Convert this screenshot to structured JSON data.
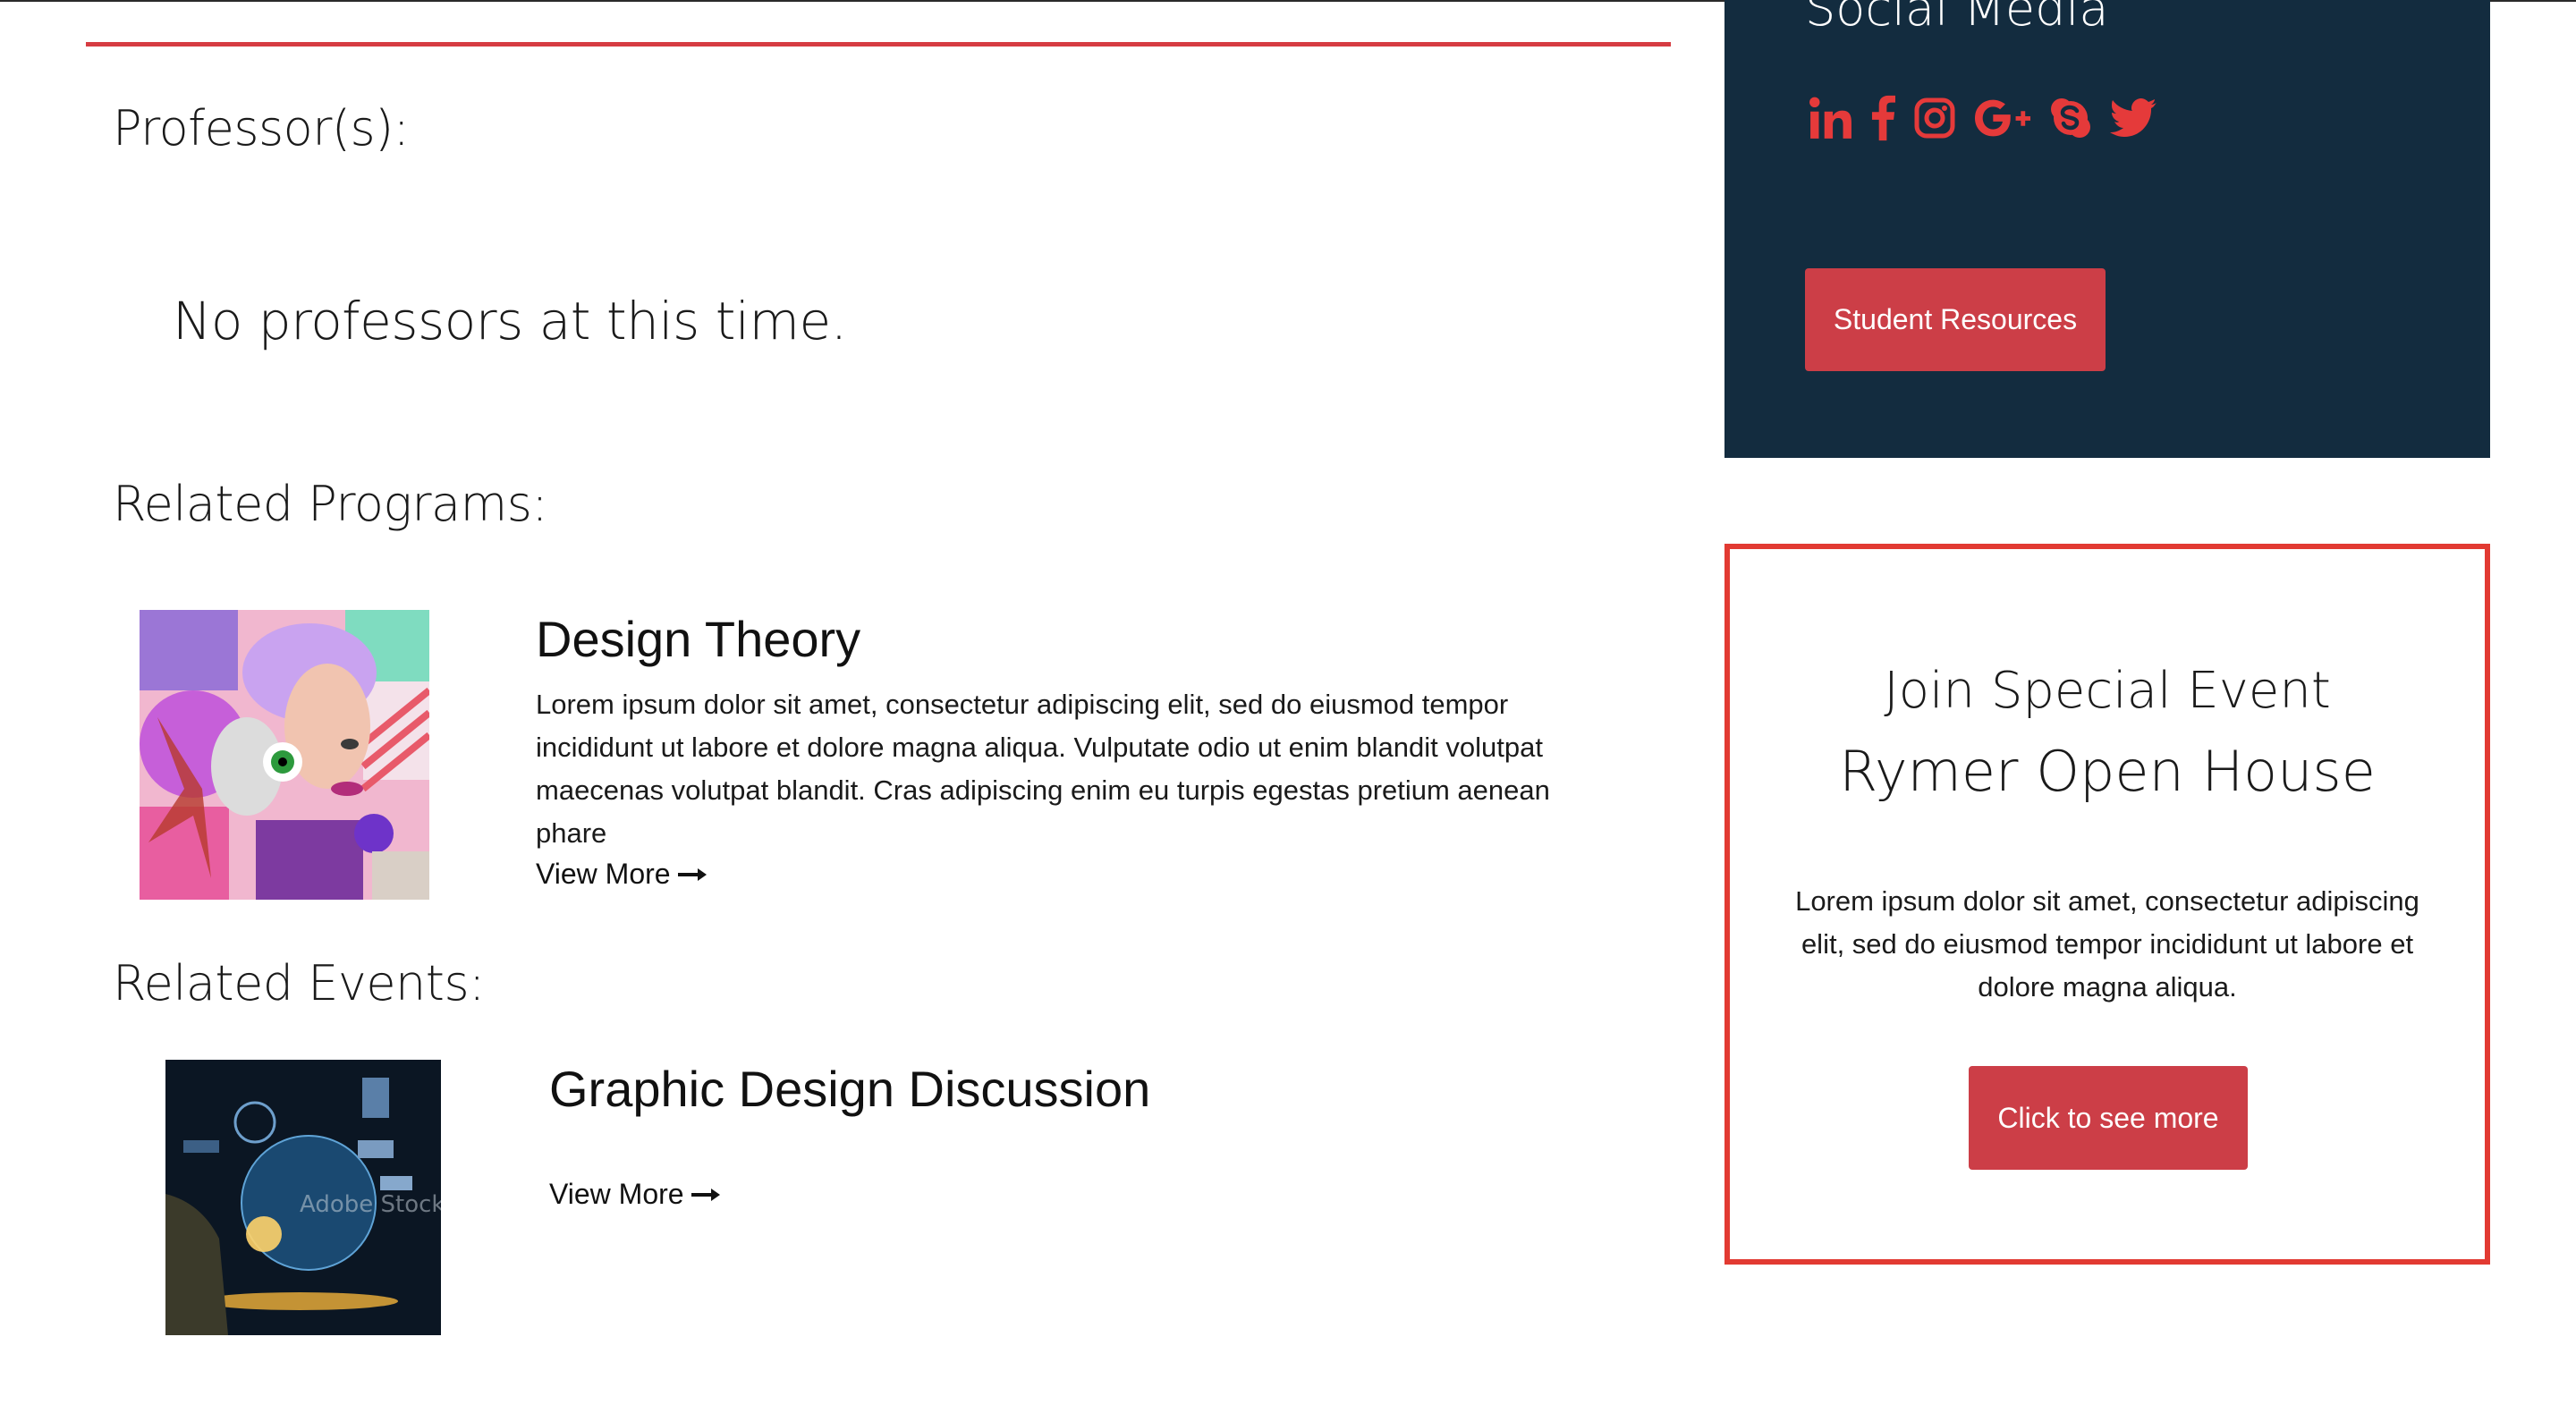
{
  "main": {
    "professors_heading": "Professor(s):",
    "no_professors_message": "No professors at this time.",
    "related_programs_heading": "Related Programs:",
    "program": {
      "title": "Design Theory",
      "description": "Lorem ipsum dolor sit amet, consectetur adipiscing elit, sed do eiusmod tempor incididunt ut labore et dolore magna aliqua. Vulputate odio ut enim blandit volutpat maecenas volutpat blandit. Cras adipiscing enim eu turpis egestas pretium aenean phare",
      "view_more_label": "View More"
    },
    "related_events_heading": "Related Events:",
    "event": {
      "title": "Graphic Design Discussion",
      "view_more_label": "View More",
      "image_watermark": "Adobe Stock"
    }
  },
  "sidebar": {
    "social_heading": "Social Media",
    "social_icons": [
      "linkedin-icon",
      "facebook-icon",
      "instagram-icon",
      "google-plus-icon",
      "skype-icon",
      "twitter-icon"
    ],
    "resources_button_label": "Student Resources",
    "special_event": {
      "line1": "Join Special Event",
      "line2": "Rymer Open House",
      "description": "Lorem ipsum dolor sit amet, consectetur adipiscing elit, sed do eiusmod tempor incididunt ut labore et dolore magna aliqua.",
      "button_label": "Click to see more"
    }
  },
  "colors": {
    "accent_red": "#cc3e47",
    "icon_red": "#e53a3a",
    "panel_navy": "#132c3f",
    "border_red": "#e23a32"
  }
}
